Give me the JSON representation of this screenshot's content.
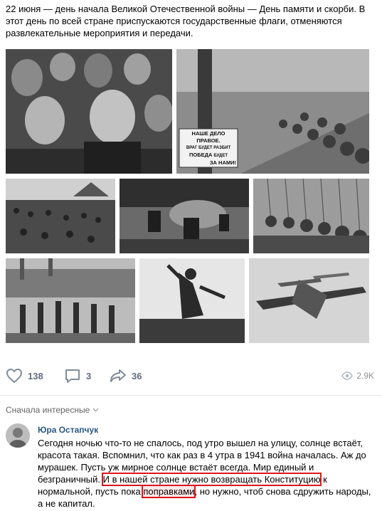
{
  "post": {
    "text": "22 июня — день начала Великой Отечественной войны — День памяти и скорби. В этот день по всей стране приспускаются государственные флаги, отменяются развлекательные мероприятия и передачи.",
    "poster_lines": [
      "НАШЕ ДЕЛО ПРАВОЕ.",
      "ВРАГ БУДЕТ РАЗБИТ",
      "ПОБЕДА",
      "БУДЕТ",
      "ЗА НАМИ!"
    ]
  },
  "actions": {
    "likes": "138",
    "comments": "3",
    "shares": "36",
    "views": "2.9K"
  },
  "comments_section": {
    "sort_label": "Сначала интересные"
  },
  "comment": {
    "author": "Юра Остапчук",
    "text_part1": "Сегодня ночью что-то не спалось, под утро вышел на улицу, солнце встаёт, красота такая. Вспомнил, что как раз в 4 утра в 1941 война началась. Аж до мурашек. Пусть уж мирное солнце встаёт всегда. Мир единый и безграничный.",
    "text_highlight1": "И в нашей стране нужно возвращать Конституцию",
    "text_part2": "к нормальной, пусть пока",
    "text_highlight2": "поправками",
    "text_part3": "но нужно, чтоб снова сдружить народы, а не капитал."
  },
  "colors": {
    "link": "#2a5885",
    "icon": "#818c99",
    "highlight_border": "#e0151b"
  }
}
